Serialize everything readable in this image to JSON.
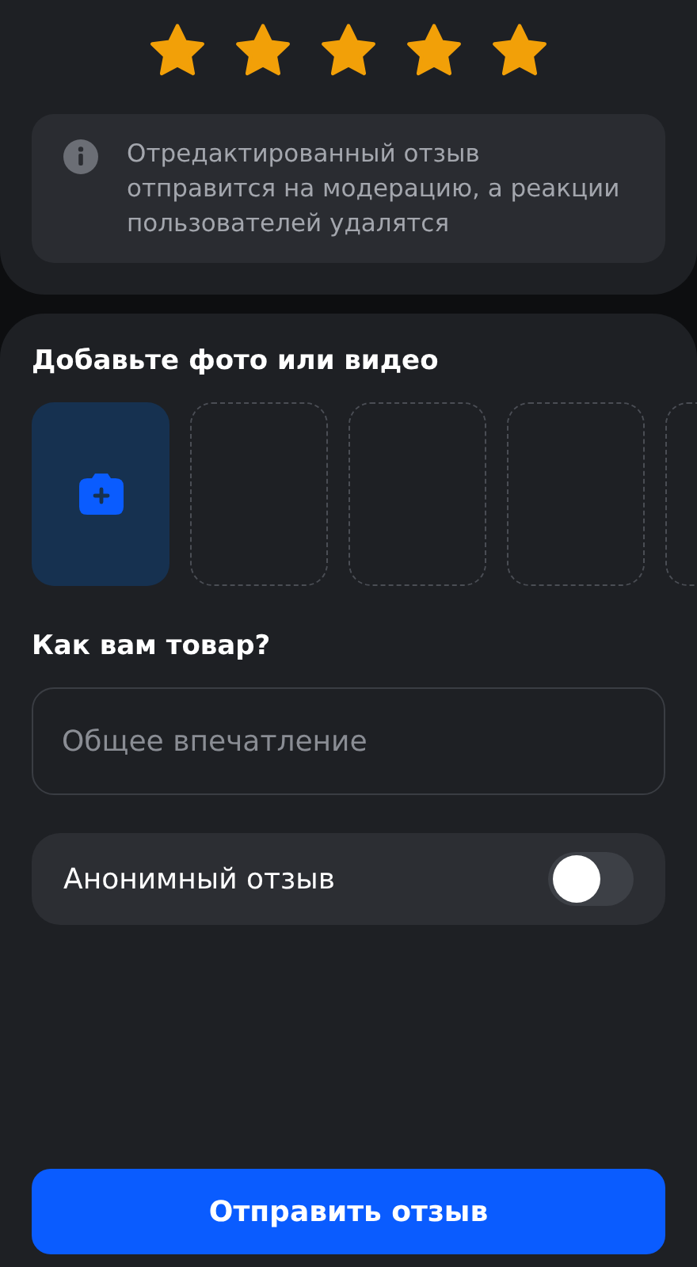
{
  "rating": {
    "stars": 5
  },
  "notice": {
    "text": "Отредактированный отзыв отправится на модерацию, а реакции пользователей удалятся"
  },
  "media": {
    "title": "Добавьте фото или видео",
    "slots": [
      {
        "kind": "upload"
      },
      {
        "kind": "empty"
      },
      {
        "kind": "empty"
      },
      {
        "kind": "empty"
      },
      {
        "kind": "empty"
      }
    ]
  },
  "impression": {
    "title": "Как вам товар?",
    "placeholder": "Общее впечатление"
  },
  "anonymous": {
    "label": "Анонимный отзыв",
    "on": false
  },
  "submit_button": "Отправить отзыв"
}
